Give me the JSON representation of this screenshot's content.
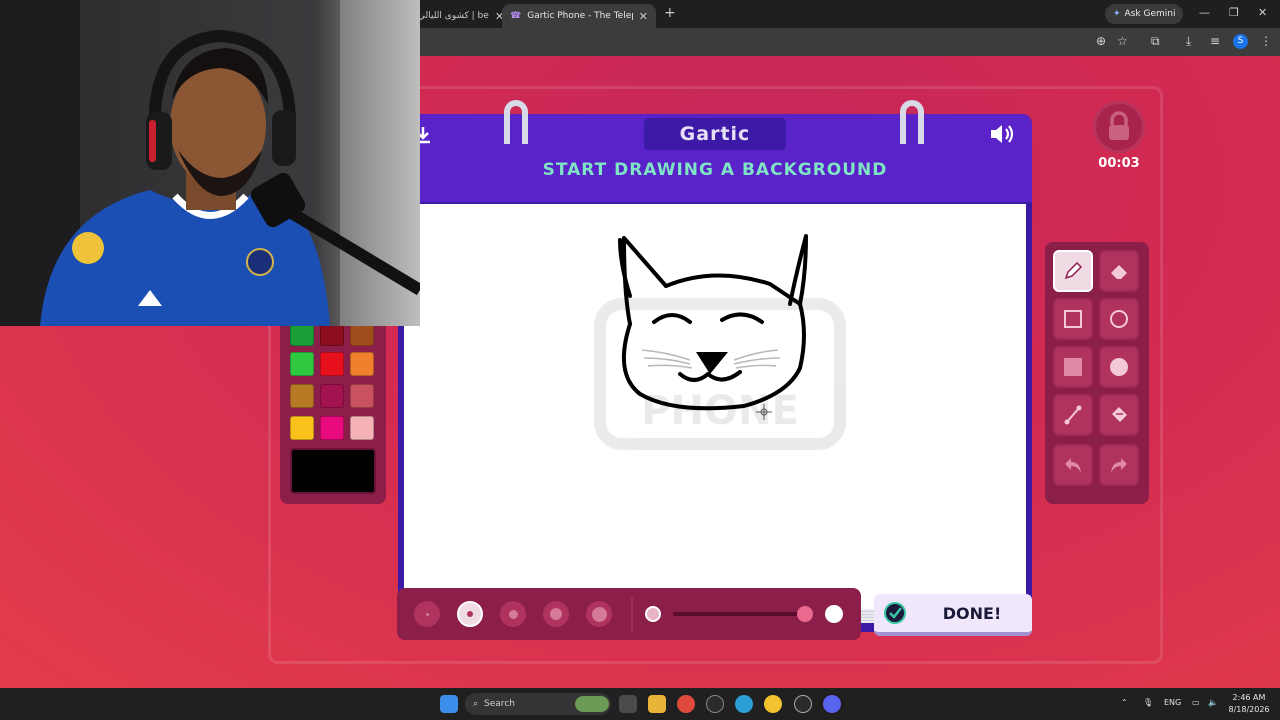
{
  "browser": {
    "tabs": [
      {
        "title": "كشوى الليالي | be",
        "active": false
      },
      {
        "title": "Gartic Phone - The Telephone G",
        "active": true
      }
    ],
    "ask_gemini": "Ask Gemini",
    "profile_initial": "S"
  },
  "game": {
    "logo": "Gartic",
    "instruction": "START DRAWING A BACKGROUND",
    "timer": "00:03",
    "done_label": "DONE!",
    "current_color": "#000000",
    "palette": [
      "#1a9e36",
      "#8c0d1c",
      "#a14d1b",
      "#2ec940",
      "#e8101c",
      "#f07f2e",
      "#b87a25",
      "#a3134f",
      "#c9525e",
      "#f9c21b",
      "#e80b7d",
      "#f5b3b8"
    ],
    "tools": [
      {
        "name": "pencil",
        "selected": true
      },
      {
        "name": "eraser",
        "selected": false
      },
      {
        "name": "rectangle-outline",
        "selected": false
      },
      {
        "name": "ellipse-outline",
        "selected": false
      },
      {
        "name": "rectangle-filled",
        "selected": false
      },
      {
        "name": "ellipse-filled",
        "selected": false
      },
      {
        "name": "line",
        "selected": false
      },
      {
        "name": "fill-bucket",
        "selected": false
      },
      {
        "name": "undo",
        "selected": false
      },
      {
        "name": "redo",
        "selected": false
      }
    ],
    "brush_sizes": [
      {
        "size": 1,
        "selected": false
      },
      {
        "size": 2,
        "selected": true
      },
      {
        "size": 3,
        "selected": false
      },
      {
        "size": 4,
        "selected": false
      },
      {
        "size": 5,
        "selected": false
      }
    ],
    "opacity_slider": 0.97
  },
  "taskbar": {
    "search_placeholder": "Search",
    "language": "ENG",
    "time": "2:46 AM",
    "date": "8/18/2026"
  },
  "colors": {
    "page_bg": "#d22a52",
    "book_purple": "#5a22c9",
    "instruction_teal": "#7fe3c6",
    "panel": "#8c1e4a"
  }
}
